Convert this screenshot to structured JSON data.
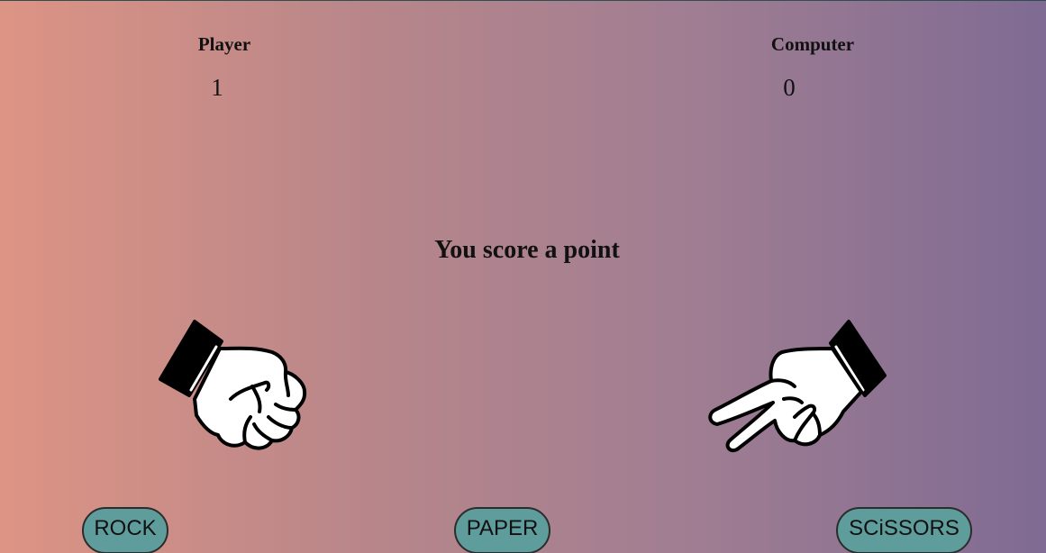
{
  "scoreboard": {
    "player": {
      "label": "Player",
      "score": "1"
    },
    "computer": {
      "label": "Computer",
      "score": "0"
    }
  },
  "result_message": "You score a point",
  "hands": {
    "player_choice": "rock",
    "computer_choice": "scissors",
    "player_icon": "rock-fist-icon",
    "computer_icon": "scissors-hand-icon"
  },
  "choices": [
    {
      "label": "ROCK"
    },
    {
      "label": "PAPER"
    },
    {
      "label": "SCiSSORS"
    }
  ],
  "colors": {
    "background_left": "#dd9484",
    "background_right": "#7f6b93",
    "button_fill": "#5f9c9c",
    "outline": "#000000",
    "hand_fill": "#ffffff"
  }
}
